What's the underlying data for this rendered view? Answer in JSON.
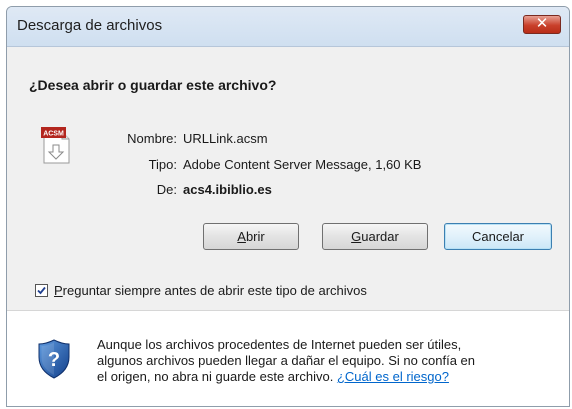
{
  "window": {
    "title": "Descarga de archivos",
    "close_glyph": "✕"
  },
  "prompt": {
    "question": "¿Desea abrir o guardar este archivo?"
  },
  "file": {
    "icon_badge": "ACSM",
    "name_label": "Nombre:",
    "name_value": "URLLink.acsm",
    "type_label": "Tipo:",
    "type_value": "Adobe Content Server Message, 1,60 KB",
    "from_label": "De:",
    "from_value": "acs4.ibiblio.es"
  },
  "buttons": {
    "open": {
      "accel": "A",
      "rest": "brir"
    },
    "save": {
      "accel": "G",
      "rest": "uardar"
    },
    "cancel": {
      "label": "Cancelar"
    }
  },
  "checkbox": {
    "checked": true,
    "accel": "P",
    "rest": "reguntar siempre antes de abrir este tipo de archivos"
  },
  "warning": {
    "line1": "Aunque los archivos procedentes de Internet pueden ser útiles,",
    "line2": "algunos archivos pueden llegar a dañar el equipo. Si no confía en",
    "line3": "el origen, no abra ni guarde este archivo.",
    "link": "¿Cuál es el riesgo?"
  },
  "colors": {
    "link": "#0066cc",
    "close_button": "#c9402b",
    "shield_blue": "#1d5fb4",
    "acsm_badge": "#b3261e"
  },
  "icons": {
    "file": "acsm-file-icon",
    "warning": "shield-question-icon",
    "close": "close-icon"
  }
}
